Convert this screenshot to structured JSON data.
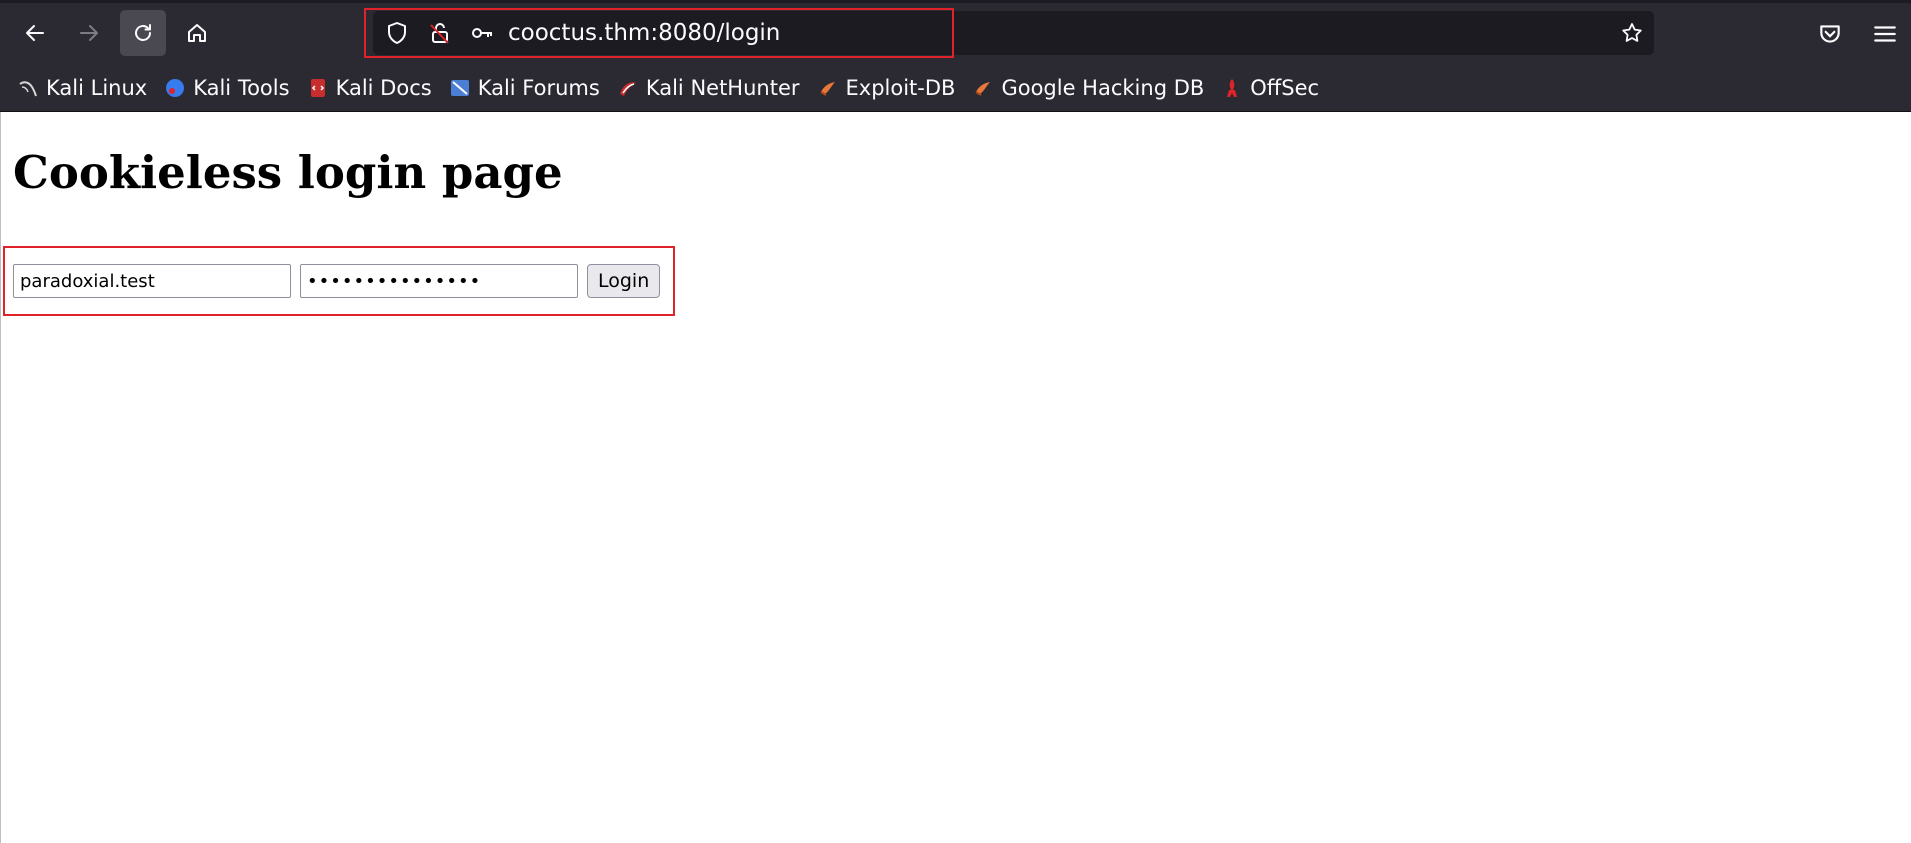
{
  "browser": {
    "url": "cooctus.thm:8080/login",
    "bookmarks": [
      {
        "label": "Kali Linux",
        "icon": "kali-dragon-icon"
      },
      {
        "label": "Kali Tools",
        "icon": "kali-tools-icon"
      },
      {
        "label": "Kali Docs",
        "icon": "kali-docs-icon"
      },
      {
        "label": "Kali Forums",
        "icon": "kali-forums-icon"
      },
      {
        "label": "Kali NetHunter",
        "icon": "kali-nethunter-icon"
      },
      {
        "label": "Exploit-DB",
        "icon": "exploit-db-icon"
      },
      {
        "label": "Google Hacking DB",
        "icon": "google-hacking-db-icon"
      },
      {
        "label": "OffSec",
        "icon": "offsec-icon"
      }
    ],
    "highlight_color": "#e0232a"
  },
  "page": {
    "title": "Cookieless login page",
    "form": {
      "username_value": "paradoxial.test",
      "password_value": "paradoxial.test",
      "login_label": "Login"
    }
  }
}
